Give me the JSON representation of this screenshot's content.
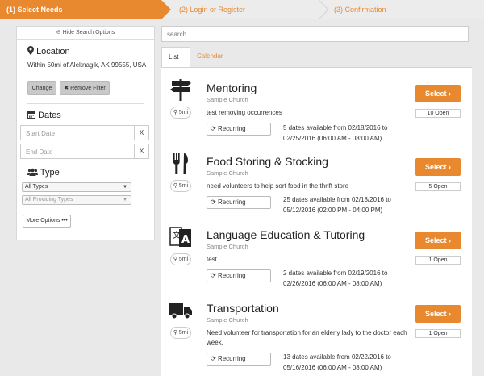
{
  "steps": {
    "step1": "(1) Select Needs",
    "step2": "(2) Login or Register",
    "step3": "(3) Confirmation",
    "accent": "#e8892f"
  },
  "sidebar": {
    "hide_options": "Hide Search Options",
    "location_title": "Location",
    "location_text": "Within 50mi of Aleknagik, AK 99555, USA",
    "change_label": "Change",
    "remove_filter_label": "Remove Filter",
    "dates_title": "Dates",
    "start_date_placeholder": "Start Date",
    "end_date_placeholder": "End Date",
    "clear_label": "X",
    "type_title": "Type",
    "type_select": "All Types",
    "providing_select": "All Providing Types",
    "more_options": "More Options"
  },
  "search": {
    "placeholder": "search"
  },
  "tabs": {
    "list": "List",
    "calendar": "Calendar"
  },
  "items": [
    {
      "title": "Mentoring",
      "org": "Sample Church",
      "distance": "5mi",
      "description": "test removing occurrences",
      "recurring": "Recurring",
      "dates": "5 dates available from 02/18/2016 to 02/25/2016 (06:00 AM - 08:00 AM)",
      "select": "Select",
      "open": "10 Open",
      "icon": "signpost-icon"
    },
    {
      "title": "Food Storing & Stocking",
      "org": "Sample Church",
      "distance": "5mi",
      "description": "need volunteers to help sort food in the thrift store",
      "recurring": "Recurring",
      "dates": "25 dates available from 02/18/2016 to 05/12/2016 (02:00 PM - 04:00 PM)",
      "select": "Select",
      "open": "5 Open",
      "icon": "utensils-icon"
    },
    {
      "title": "Language Education & Tutoring",
      "org": "Sample Church",
      "distance": "5mi",
      "description": "test",
      "recurring": "Recurring",
      "dates": "2 dates available from 02/19/2016 to 02/26/2016 (06:00 AM - 08:00 AM)",
      "select": "Select",
      "open": "1 Open",
      "icon": "translate-icon"
    },
    {
      "title": "Transportation",
      "org": "Sample Church",
      "distance": "5mi",
      "description": "Need volunteer for transportation for an elderly lady to the doctor each week.",
      "recurring": "Recurring",
      "dates": "13 dates available from 02/22/2016 to 05/16/2016 (06:00 AM - 08:00 AM)",
      "select": "Select",
      "open": "1 Open",
      "icon": "truck-icon"
    }
  ]
}
